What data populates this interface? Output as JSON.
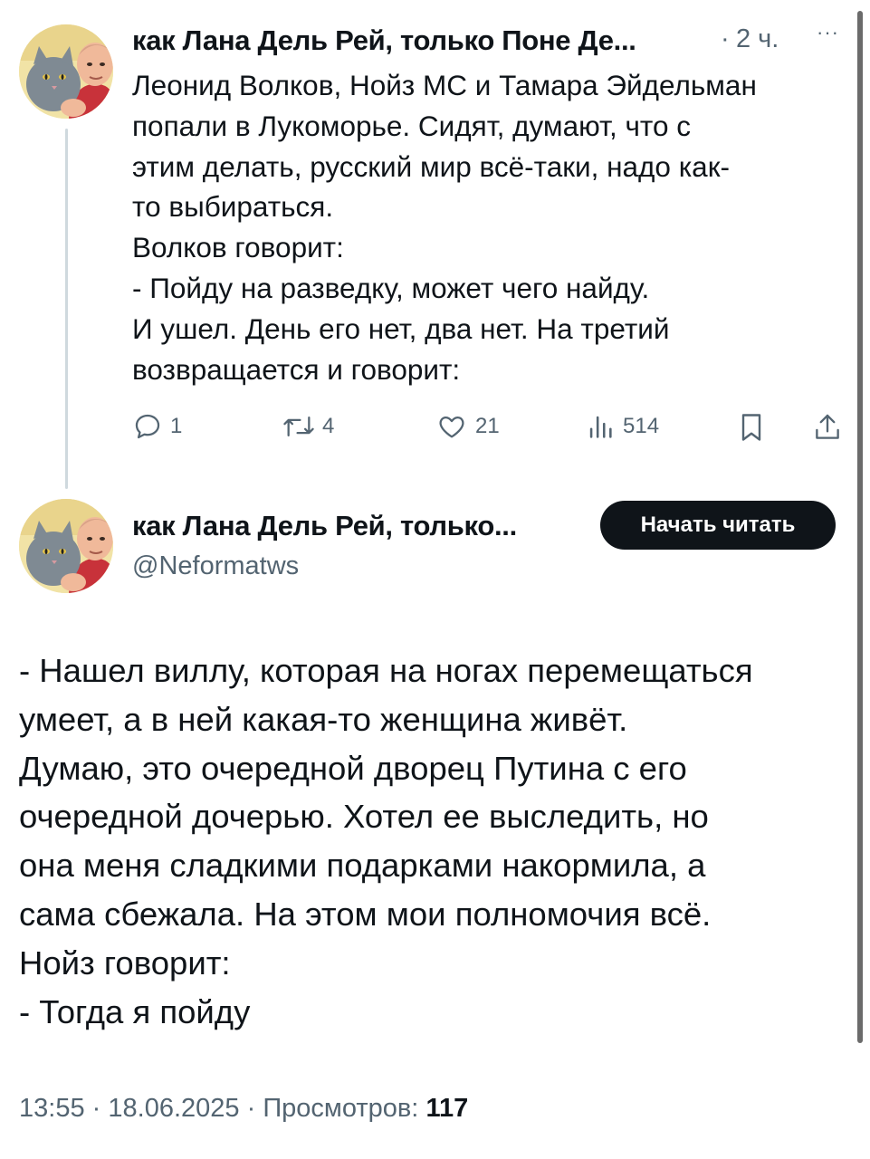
{
  "reply_tweet": {
    "author_name": "как Лана Дель Рей, только Поне Де...",
    "separator": "·",
    "time": "2 ч.",
    "more": "···",
    "lines": [
      "Леонид Волков, Нойз МС и Тамара Эйдельман",
      "попали в Лукоморье. Сидят, думают, что с",
      "этим делать, русский мир всё-таки, надо как-",
      "то выбираться.",
      "Волков говорит:",
      "- Пойду на разведку, может чего найду.",
      "И ушел. День его нет, два нет. На третий",
      "возвращается и говорит:"
    ],
    "actions": {
      "replies": "1",
      "retweets": "4",
      "likes": "21",
      "views": "514"
    },
    "icons": [
      "reply-icon",
      "retweet-icon",
      "like-icon",
      "views-icon",
      "bookmark-icon",
      "share-icon"
    ]
  },
  "main_tweet": {
    "author_name": "как Лана Дель Рей, только...",
    "handle": "@Neformatws",
    "follow_button": "Начать читать",
    "lines": [
      "- Нашел виллу, которая на ногах перемещаться",
      "умеет, а в ней какая-то женщина живёт.",
      "Думаю, это очередной дворец Путина с его",
      "очередной дочерью. Хотел ее выследить, но",
      "она меня сладкими подарками накормила, а",
      "сама сбежала. На этом мои полномочия всё.",
      "Нойз говорит:",
      "- Тогда я пойду"
    ],
    "footer": {
      "time": "13:55",
      "dot1": "·",
      "date": "18.06.2025",
      "dot2": "·",
      "views_label": "Просмотров:",
      "views_count": "117"
    }
  },
  "colors": {
    "text": "#0f1419",
    "secondary": "#536471",
    "thread_line": "#cfd9de",
    "button_bg": "#0f1419",
    "button_text": "#ffffff"
  }
}
